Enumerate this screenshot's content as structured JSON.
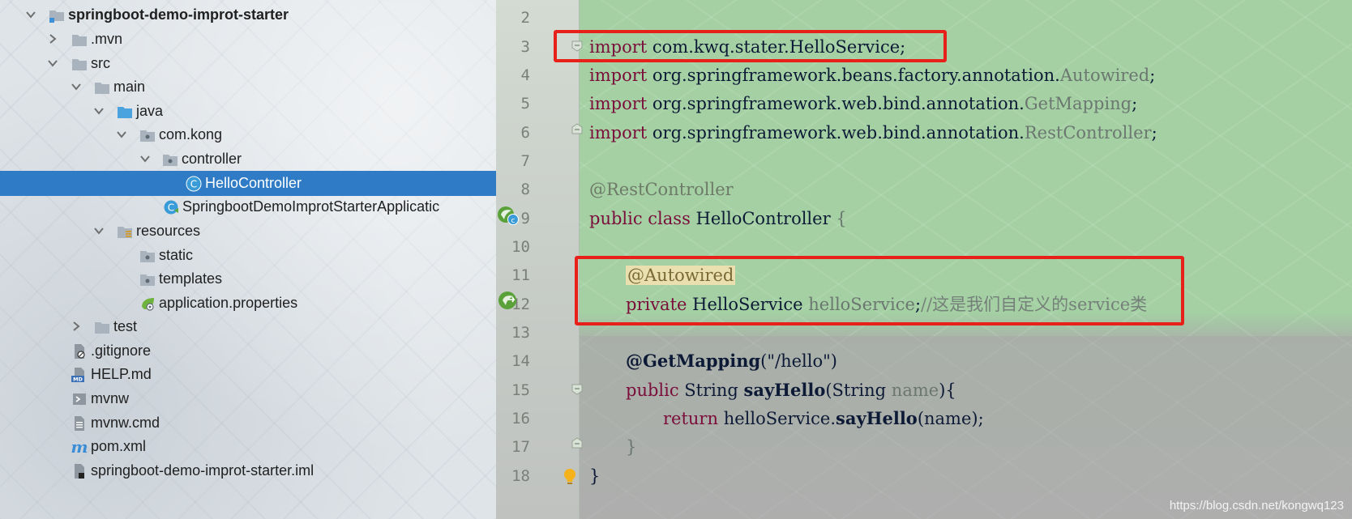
{
  "project_tree": {
    "items": [
      {
        "label": "springboot-demo-improt-starter",
        "bold": true
      },
      {
        "label": ".mvn"
      },
      {
        "label": "src"
      },
      {
        "label": "main"
      },
      {
        "label": "java"
      },
      {
        "label": "com.kong"
      },
      {
        "label": "controller"
      },
      {
        "label": "HelloController",
        "selected": true
      },
      {
        "label": "SpringbootDemoImprotStarterApplicatic"
      },
      {
        "label": "resources"
      },
      {
        "label": "static"
      },
      {
        "label": "templates"
      },
      {
        "label": "application.properties"
      },
      {
        "label": "test"
      },
      {
        "label": ".gitignore"
      },
      {
        "label": "HELP.md"
      },
      {
        "label": "mvnw"
      },
      {
        "label": "mvnw.cmd"
      },
      {
        "label": "pom.xml"
      },
      {
        "label": "springboot-demo-improt-starter.iml"
      }
    ]
  },
  "editor": {
    "line_numbers": [
      "2",
      "3",
      "4",
      "5",
      "6",
      "7",
      "8",
      "9",
      "10",
      "11",
      "12",
      "13",
      "14",
      "15",
      "16",
      "17",
      "18"
    ],
    "code": {
      "l3": {
        "kw": "import",
        "pkg": "com.kwq.stater.",
        "cls": "HelloService",
        "end": ";"
      },
      "l4": {
        "kw": "import",
        "pkg": "org.springframework.beans.factory.annotation.",
        "cls": "Autowired",
        "end": ";"
      },
      "l5": {
        "kw": "import",
        "pkg": "org.springframework.web.bind.annotation.",
        "cls": "GetMapping",
        "end": ";"
      },
      "l6": {
        "kw": "import",
        "pkg": "org.springframework.web.bind.annotation.",
        "cls": "RestController",
        "end": ";"
      },
      "l8": {
        "ann": "@RestController"
      },
      "l9": {
        "kw1": "public",
        "kw2": "class",
        "cls": "HelloController",
        "end": "{"
      },
      "l11": {
        "ann": "@Autowired"
      },
      "l12": {
        "kw": "private",
        "type": "HelloService",
        "field": "helloService",
        "semi": ";",
        "comment": "//这是我们自定义的service类"
      },
      "l14": {
        "ann": "@GetMapping",
        "args": "(\"/hello\")"
      },
      "l15": {
        "kw": "public",
        "type": "String",
        "method": "sayHello",
        "open": "(",
        "ptype": "String",
        "pname": "name",
        "close": "){"
      },
      "l16": {
        "kw": "return",
        "obj": "helloService.",
        "call": "sayHello",
        "args": "(name);"
      },
      "l17": {
        "text": "}"
      },
      "l18": {
        "text": "}"
      }
    }
  },
  "watermark": "https://blog.csdn.net/kongwq123",
  "colors": {
    "selection": "#2f7bc6",
    "highlight_box": "#e8201a",
    "keyword": "#000080",
    "annotation_highlight": "#eadfae"
  }
}
